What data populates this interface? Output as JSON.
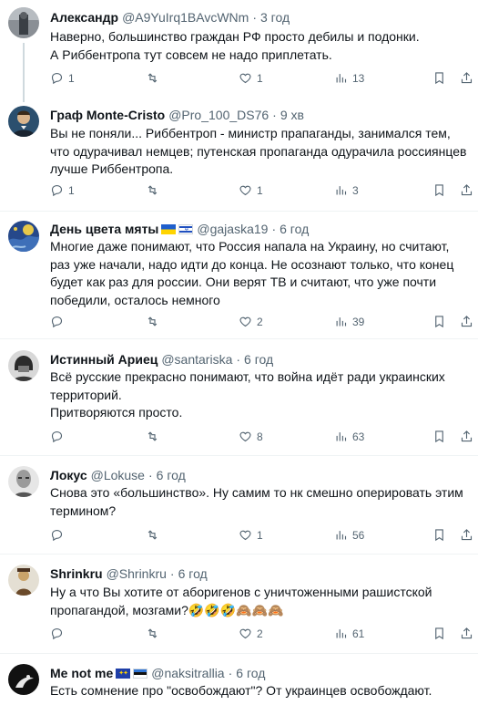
{
  "posts": [
    {
      "name": "Александр",
      "handle": "@A9YuIrq1BAvcWNm",
      "time": "3 год",
      "text": "Наверно, большинство граждан РФ просто дебилы и подонки.\nА Риббентропа тут совсем не надо приплетать.",
      "replies": "1",
      "retweets": "",
      "likes": "1",
      "views": "13",
      "avatar_icon": "avatar-photo",
      "flags": []
    },
    {
      "name": "Граф Monte-Cristo",
      "handle": "@Pro_100_DS76",
      "time": "9 хв",
      "text": "Вы не поняли... Риббентроп - министр прапаганды, занимался тем, что одурачивал немцев; путенская пропаганда одурачила россиянцев лучше Риббентропа.",
      "replies": "1",
      "retweets": "",
      "likes": "1",
      "views": "3",
      "avatar_icon": "avatar-portrait",
      "flags": []
    },
    {
      "name": "День цвета мяты",
      "handle": "@gajaska19",
      "time": "6 год",
      "text": "Многие даже понимают, что Россия напала на Украину, но считают, раз уже начали, надо идти до конца. Не осознают только, что конец будет как раз для россии. Они верят ТВ и считают, что уже почти победили, осталось немного",
      "replies": "",
      "retweets": "",
      "likes": "2",
      "views": "39",
      "avatar_icon": "avatar-painting",
      "flags": [
        "ua",
        "il"
      ]
    },
    {
      "name": "Истинный Ариец",
      "handle": "@santariska",
      "time": "6 год",
      "text": "Всё русские прекрасно понимают, что война идёт ради украинских территорий.\nПритворяются просто.",
      "replies": "",
      "retweets": "",
      "likes": "8",
      "views": "63",
      "avatar_icon": "avatar-helmet",
      "flags": []
    },
    {
      "name": "Локус",
      "handle": "@Lokuse",
      "time": "6 год",
      "text": "Снова это «большинство». Ну самим то нк смешно оперировать этим термином?",
      "replies": "",
      "retweets": "",
      "likes": "1",
      "views": "56",
      "avatar_icon": "avatar-face",
      "flags": []
    },
    {
      "name": "Shrinkru",
      "handle": "@Shrinkru",
      "time": "6 год",
      "text": "Ну а что Вы хотите от аборигенов с уничтоженными рашистской пропагандой, мозгами?🤣🤣🤣🙈🙈🙈",
      "replies": "",
      "retweets": "",
      "likes": "2",
      "views": "61",
      "avatar_icon": "avatar-figure",
      "flags": []
    },
    {
      "name": "Me not me",
      "handle": "@naksitrallia",
      "time": "6 год",
      "text": "Есть сомнение про \"освобождают\"? От украинцев  освобождают.",
      "replies": "",
      "retweets": "",
      "likes": "",
      "views": "",
      "avatar_icon": "avatar-bird",
      "flags": [
        "eu",
        "ee"
      ]
    }
  ],
  "icons": {
    "reply": "reply-icon",
    "retweet": "retweet-icon",
    "like": "like-icon",
    "views": "views-icon",
    "bookmark": "bookmark-icon",
    "share": "share-icon"
  },
  "colors": {
    "text": "#0f1419",
    "secondary": "#536471",
    "divider": "#eff3f4",
    "thread_line": "#cfd9de"
  }
}
